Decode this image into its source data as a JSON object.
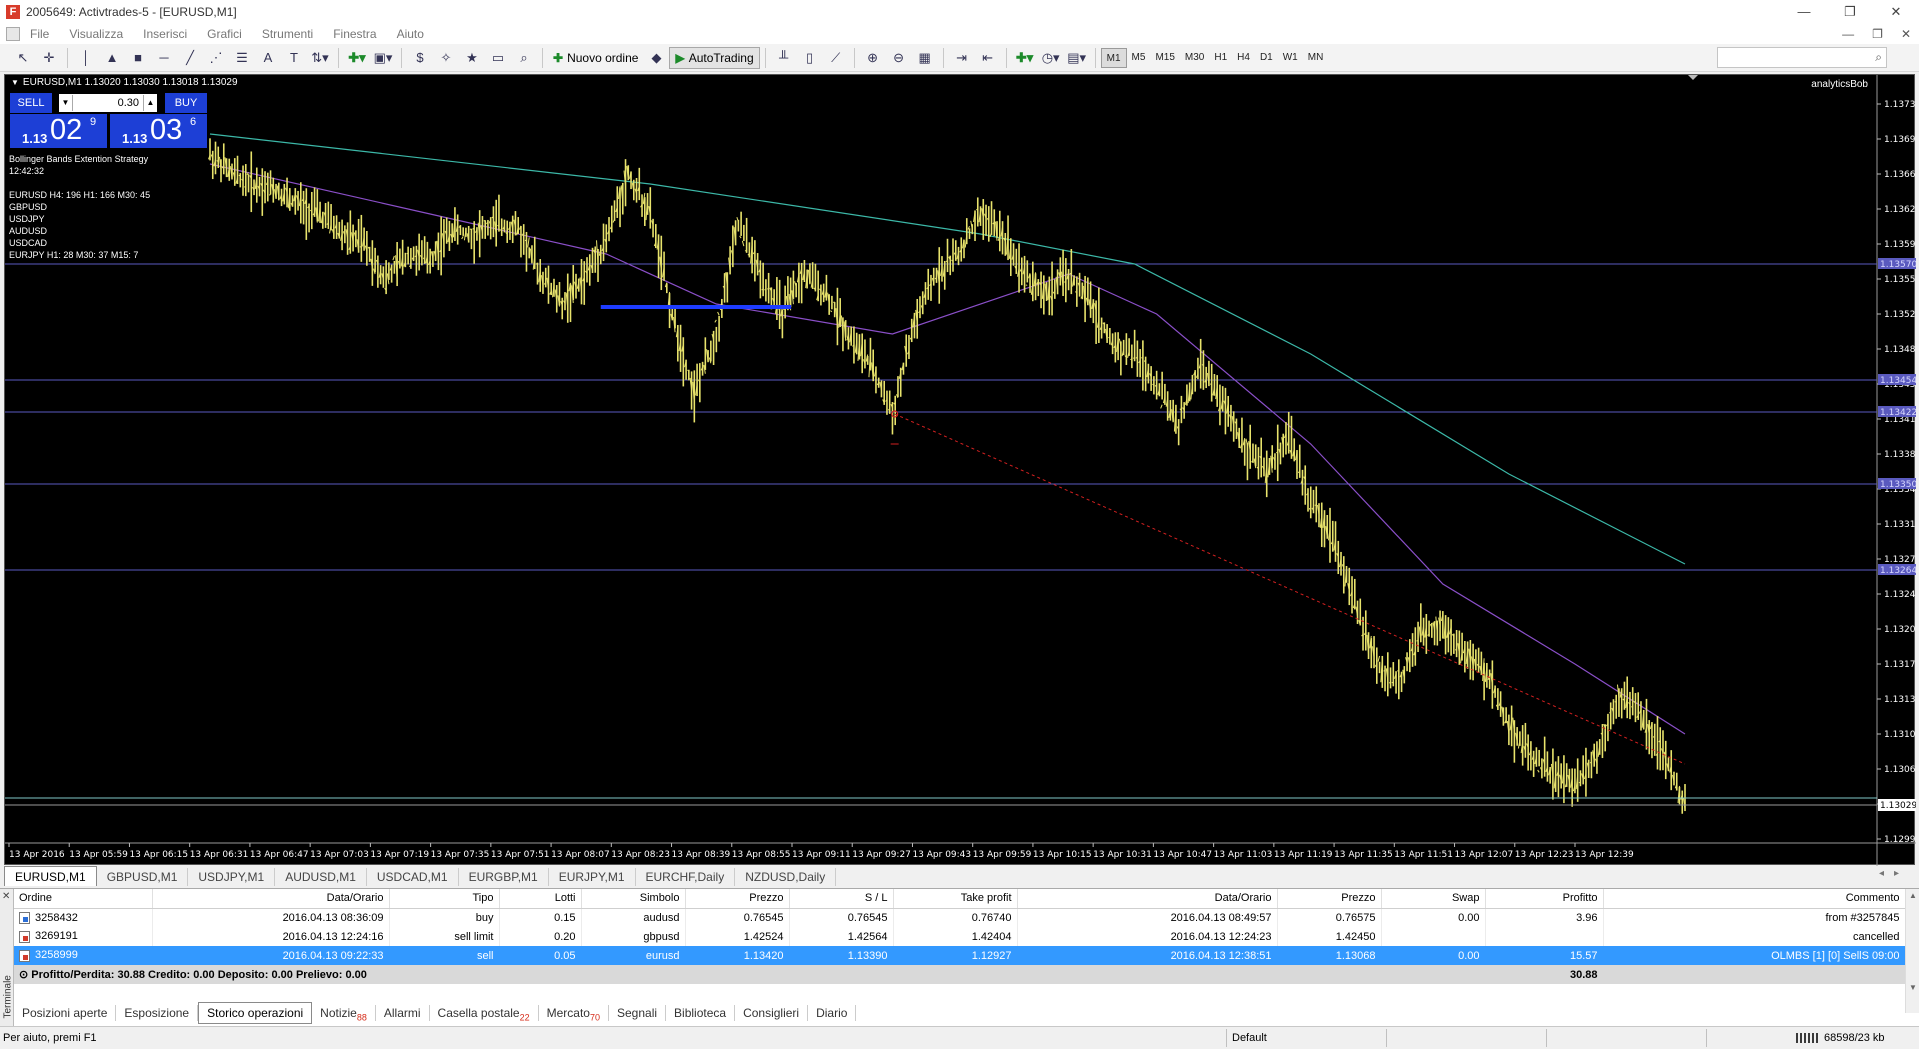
{
  "window": {
    "title": "2005649: Activtrades-5 - [EURUSD,M1]",
    "app_icon_letter": "F",
    "controls": [
      "—",
      "❐",
      "✕"
    ]
  },
  "menu": {
    "items": [
      "File",
      "Visualizza",
      "Inserisci",
      "Grafici",
      "Strumenti",
      "Finestra",
      "Aiuto"
    ],
    "mdi_controls": [
      "—",
      "❐",
      "✕"
    ]
  },
  "toolbar": {
    "new_order_label": "Nuovo ordine",
    "autotrading_label": "AutoTrading",
    "timeframes": [
      "M1",
      "M5",
      "M15",
      "M30",
      "H1",
      "H4",
      "D1",
      "W1",
      "MN"
    ],
    "active_timeframe": "M1",
    "search_placeholder": ""
  },
  "chart": {
    "header_text": "EURUSD,M1  1.13020 1.13030 1.13018 1.13029",
    "author": "analyticsBob",
    "trade_panel": {
      "sell_label": "SELL",
      "buy_label": "BUY",
      "lots": "0.30",
      "sell_price_small": "1.13",
      "sell_price_big": "02",
      "sell_price_sup": "9",
      "buy_price_small": "1.13",
      "buy_price_big": "03",
      "buy_price_sup": "6"
    },
    "info_lines": [
      "Bollinger Bands Extention Strategy",
      "12:42:32"
    ],
    "pair_lines": [
      "EURUSD H4: 196  H1: 166  M30: 45",
      "GBPUSD",
      "USDJPY",
      "AUDUSD",
      "USDCAD",
      "EURJPY H1: 28  M30: 37  M15: 7"
    ],
    "colors": {
      "background": "#000000",
      "price_bars": "#e8e36c",
      "ma_slow": "#3cb8a8",
      "ma_fast": "#8a4fc8",
      "hlines": "#5a5abf",
      "blue_bar": "#1e3cff",
      "trendline": "#d22020",
      "last_price_line": "#7fc8c8"
    }
  },
  "chart_data": {
    "type": "candlestick",
    "title": "EURUSD,M1",
    "y_ticks": [
      "1.13730",
      "1.13695",
      "1.13660",
      "1.13625",
      "1.13590",
      "1.13555",
      "1.13520",
      "1.13485",
      "1.13450",
      "1.13415",
      "1.13380",
      "1.13345",
      "1.13310",
      "1.13275",
      "1.13240",
      "1.13205",
      "1.13170",
      "1.13135",
      "1.13100",
      "1.13065",
      "1.13030",
      "1.12995"
    ],
    "ylim": [
      1.12995,
      1.13745
    ],
    "x_ticks": [
      "13 Apr 2016",
      "13 Apr 05:59",
      "13 Apr 06:15",
      "13 Apr 06:31",
      "13 Apr 06:47",
      "13 Apr 07:03",
      "13 Apr 07:19",
      "13 Apr 07:35",
      "13 Apr 07:51",
      "13 Apr 08:07",
      "13 Apr 08:23",
      "13 Apr 08:39",
      "13 Apr 08:55",
      "13 Apr 09:11",
      "13 Apr 09:27",
      "13 Apr 09:43",
      "13 Apr 09:59",
      "13 Apr 10:15",
      "13 Apr 10:31",
      "13 Apr 10:47",
      "13 Apr 11:03",
      "13 Apr 11:19",
      "13 Apr 11:35",
      "13 Apr 11:51",
      "13 Apr 12:07",
      "13 Apr 12:23",
      "13 Apr 12:39"
    ],
    "horizontal_lines": [
      {
        "price": 1.1357,
        "label": "1.13570"
      },
      {
        "price": 1.13454,
        "label": "1.13454"
      },
      {
        "price": 1.13422,
        "label": "1.13422"
      },
      {
        "price": 1.1335,
        "label": "1.13350"
      },
      {
        "price": 1.13264,
        "label": "1.13264"
      }
    ],
    "price_path": [
      [
        0,
        1.1368
      ],
      [
        2,
        1.1366
      ],
      [
        4,
        1.1365
      ],
      [
        6,
        1.13645
      ],
      [
        8,
        1.1363
      ],
      [
        10,
        1.1362
      ],
      [
        12,
        1.136
      ],
      [
        14,
        1.1359
      ],
      [
        16,
        1.13555
      ],
      [
        18,
        1.1358
      ],
      [
        20,
        1.13575
      ],
      [
        22,
        1.13605
      ],
      [
        24,
        1.136
      ],
      [
        26,
        1.1361
      ],
      [
        28,
        1.13605
      ],
      [
        30,
        1.1356
      ],
      [
        32,
        1.1353
      ],
      [
        34,
        1.13555
      ],
      [
        36,
        1.13595
      ],
      [
        38,
        1.1366
      ],
      [
        40,
        1.1362
      ],
      [
        42,
        1.1352
      ],
      [
        44,
        1.1344
      ],
      [
        46,
        1.135
      ],
      [
        48,
        1.1361
      ],
      [
        50,
        1.1356
      ],
      [
        52,
        1.1352
      ],
      [
        54,
        1.1356
      ],
      [
        56,
        1.1354
      ],
      [
        58,
        1.135
      ],
      [
        60,
        1.1347
      ],
      [
        62,
        1.1342
      ],
      [
        64,
        1.1351
      ],
      [
        66,
        1.1356
      ],
      [
        68,
        1.1358
      ],
      [
        70,
        1.1362
      ],
      [
        72,
        1.136
      ],
      [
        74,
        1.1356
      ],
      [
        76,
        1.1354
      ],
      [
        78,
        1.1356
      ],
      [
        80,
        1.1353
      ],
      [
        82,
        1.1349
      ],
      [
        84,
        1.1348
      ],
      [
        86,
        1.1345
      ],
      [
        88,
        1.1341
      ],
      [
        90,
        1.1347
      ],
      [
        92,
        1.1343
      ],
      [
        94,
        1.1339
      ],
      [
        96,
        1.1336
      ],
      [
        98,
        1.134
      ],
      [
        100,
        1.1333
      ],
      [
        102,
        1.133
      ],
      [
        104,
        1.1323
      ],
      [
        106,
        1.1317
      ],
      [
        108,
        1.1315
      ],
      [
        110,
        1.132
      ],
      [
        112,
        1.1321
      ],
      [
        114,
        1.1318
      ],
      [
        116,
        1.1316
      ],
      [
        118,
        1.1311
      ],
      [
        120,
        1.1308
      ],
      [
        122,
        1.1306
      ],
      [
        124,
        1.1305
      ],
      [
        126,
        1.1308
      ],
      [
        128,
        1.1314
      ],
      [
        130,
        1.1312
      ],
      [
        132,
        1.1308
      ],
      [
        134,
        1.13029
      ]
    ],
    "ma_slow": [
      [
        0,
        1.137
      ],
      [
        40,
        1.1365
      ],
      [
        70,
        1.136
      ],
      [
        84,
        1.1357
      ],
      [
        100,
        1.1348
      ],
      [
        118,
        1.1336
      ],
      [
        134,
        1.1327
      ]
    ],
    "ma_fast": [
      [
        0,
        1.1367
      ],
      [
        20,
        1.1362
      ],
      [
        36,
        1.1358
      ],
      [
        46,
        1.1353
      ],
      [
        62,
        1.135
      ],
      [
        78,
        1.1356
      ],
      [
        86,
        1.1352
      ],
      [
        100,
        1.1339
      ],
      [
        112,
        1.1325
      ],
      [
        124,
        1.1317
      ],
      [
        134,
        1.131
      ]
    ],
    "last_price": 1.13029,
    "bid_line": 1.13036
  },
  "chart_tabs": [
    "EURUSD,M1",
    "GBPUSD,M1",
    "USDJPY,M1",
    "AUDUSD,M1",
    "USDCAD,M1",
    "EURGBP,M1",
    "EURJPY,M1",
    "EURCHF,Daily",
    "NZDUSD,Daily"
  ],
  "terminal": {
    "side_label": "Terminale",
    "columns": [
      "Ordine",
      "Data/Orario",
      "Tipo",
      "Lotti",
      "Simbolo",
      "Prezzo",
      "S / L",
      "Take profit",
      "Data/Orario",
      "Prezzo",
      "Swap",
      "Profitto",
      "Commento"
    ],
    "rows": [
      {
        "icon": "buy",
        "cells": [
          "3258432",
          "2016.04.13 08:36:09",
          "buy",
          "0.15",
          "audusd",
          "0.76545",
          "0.76545",
          "0.76740",
          "2016.04.13 08:49:57",
          "0.76575",
          "0.00",
          "3.96",
          "from #3257845"
        ]
      },
      {
        "icon": "sell",
        "cells": [
          "3269191",
          "2016.04.13 12:24:16",
          "sell limit",
          "0.20",
          "gbpusd",
          "1.42524",
          "1.42564",
          "1.42404",
          "2016.04.13 12:24:23",
          "1.42450",
          "",
          "",
          "cancelled"
        ]
      },
      {
        "icon": "sell",
        "cells": [
          "3258999",
          "2016.04.13 09:22:33",
          "sell",
          "0.05",
          "eurusd",
          "1.13420",
          "1.13390",
          "1.12927",
          "2016.04.13 12:38:51",
          "1.13068",
          "0.00",
          "15.57",
          "OLMBS [1] [0] SellS 09:00"
        ]
      }
    ],
    "summary_text": "Profitto/Perdita: 30.88  Credito: 0.00  Deposito: 0.00  Prelievo: 0.00",
    "summary_total": "30.88",
    "tabs": [
      {
        "label": "Posizioni aperte",
        "count": ""
      },
      {
        "label": "Esposizione",
        "count": ""
      },
      {
        "label": "Storico operazioni",
        "count": ""
      },
      {
        "label": "Notizie",
        "count": "88"
      },
      {
        "label": "Allarmi",
        "count": ""
      },
      {
        "label": "Casella postale",
        "count": "22"
      },
      {
        "label": "Mercato",
        "count": "70"
      },
      {
        "label": "Segnali",
        "count": ""
      },
      {
        "label": "Biblioteca",
        "count": ""
      },
      {
        "label": "Consiglieri",
        "count": ""
      },
      {
        "label": "Diario",
        "count": ""
      }
    ],
    "active_tab": "Storico operazioni"
  },
  "status": {
    "help": "Per aiuto, premi F1",
    "profile": "Default",
    "connection": "68598/23 kb"
  }
}
